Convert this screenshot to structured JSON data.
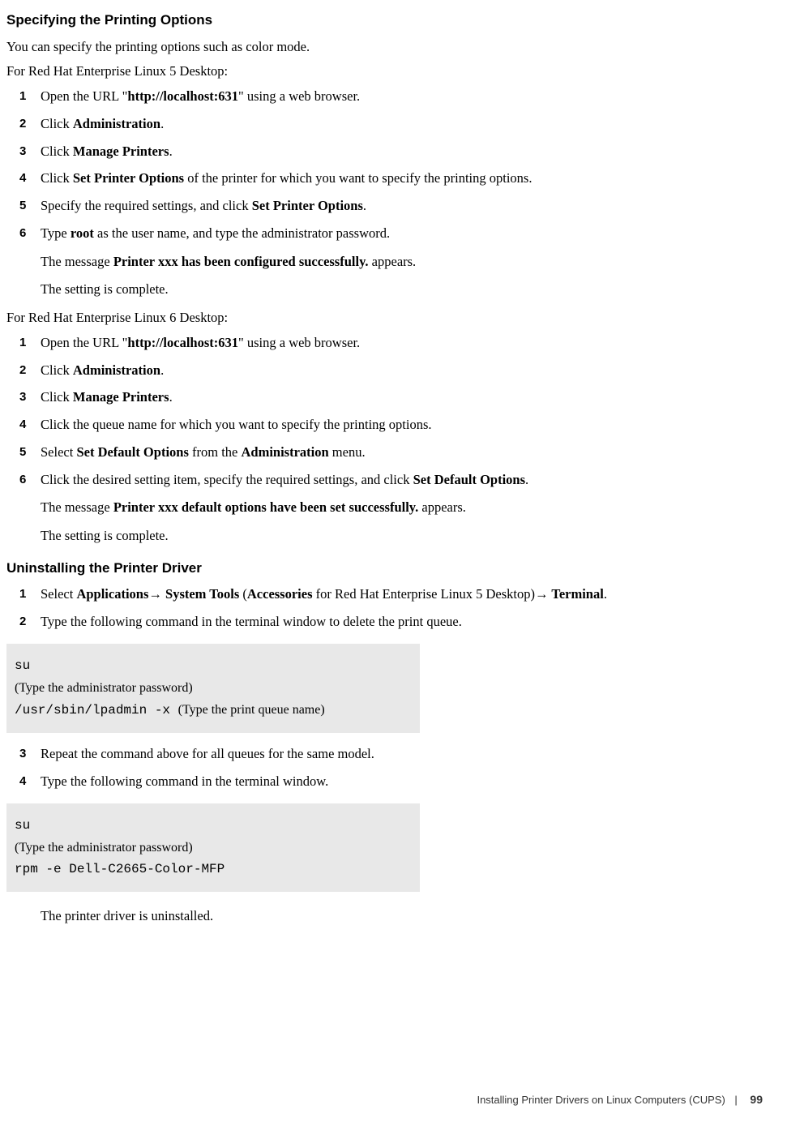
{
  "heading1": "Specifying the Printing Options",
  "intro": "You can specify the printing options such as color mode.",
  "rh5_intro": "For Red Hat Enterprise Linux 5 Desktop:",
  "rh5_steps": {
    "s1_a": "Open the URL \"",
    "s1_b": "http://localhost:631",
    "s1_c": "\" using a web browser.",
    "s2_a": "Click ",
    "s2_b": "Administration",
    "s2_c": ".",
    "s3_a": "Click ",
    "s3_b": "Manage Printers",
    "s3_c": ".",
    "s4_a": "Click ",
    "s4_b": "Set Printer Options",
    "s4_c": " of the printer for which you want to specify the printing options.",
    "s5_a": "Specify the required settings, and click ",
    "s5_b": "Set Printer Options",
    "s5_c": ".",
    "s6_a": "Type ",
    "s6_b": "root",
    "s6_c": " as the user name, and type the administrator password.",
    "s6_msg_a": "The message ",
    "s6_msg_b": "Printer xxx has been configured successfully.",
    "s6_msg_c": " appears.",
    "s6_done": "The setting is complete."
  },
  "rh6_intro": "For Red Hat Enterprise Linux 6 Desktop:",
  "rh6_steps": {
    "s1_a": "Open the URL \"",
    "s1_b": "http://localhost:631",
    "s1_c": "\" using a web browser.",
    "s2_a": "Click ",
    "s2_b": "Administration",
    "s2_c": ".",
    "s3_a": "Click ",
    "s3_b": "Manage Printers",
    "s3_c": ".",
    "s4": "Click the queue name for which you want to specify the printing options.",
    "s5_a": "Select ",
    "s5_b": "Set Default Options",
    "s5_c": " from the ",
    "s5_d": "Administration",
    "s5_e": " menu.",
    "s6_a": "Click the desired setting item, specify the required settings, and click ",
    "s6_b": "Set Default Options",
    "s6_c": ".",
    "s6_msg_a": "The message ",
    "s6_msg_b": "Printer xxx default options have been set successfully.",
    "s6_msg_c": " appears.",
    "s6_done": "The setting is complete."
  },
  "heading2": "Uninstalling the Printer Driver",
  "uninstall": {
    "s1_a": "Select ",
    "s1_b": "Applications",
    "s1_c": " System Tools",
    "s1_d": " (",
    "s1_e": "Accessories",
    "s1_f": " for Red Hat Enterprise Linux 5 Desktop)",
    "s1_g": " Terminal",
    "s1_h": ".",
    "s2": "Type the following command in the terminal window to delete the print queue.",
    "code1_l1": "su",
    "code1_l2": "(Type the administrator password)",
    "code1_l3a": "/usr/sbin/lpadmin -x ",
    "code1_l3b": "(Type the print queue name)",
    "s3": "Repeat the command above for all queues for the same model.",
    "s4": "Type the following command in the terminal window.",
    "code2_l1": "su",
    "code2_l2": "(Type the administrator password)",
    "code2_l3": "rpm -e Dell-C2665-Color-MFP",
    "done": "The printer driver is uninstalled."
  },
  "nums": {
    "n1": "1",
    "n2": "2",
    "n3": "3",
    "n4": "4",
    "n5": "5",
    "n6": "6"
  },
  "footer": {
    "text": "Installing Printer Drivers on Linux Computers (CUPS)",
    "page": "99"
  },
  "arrow": "→"
}
